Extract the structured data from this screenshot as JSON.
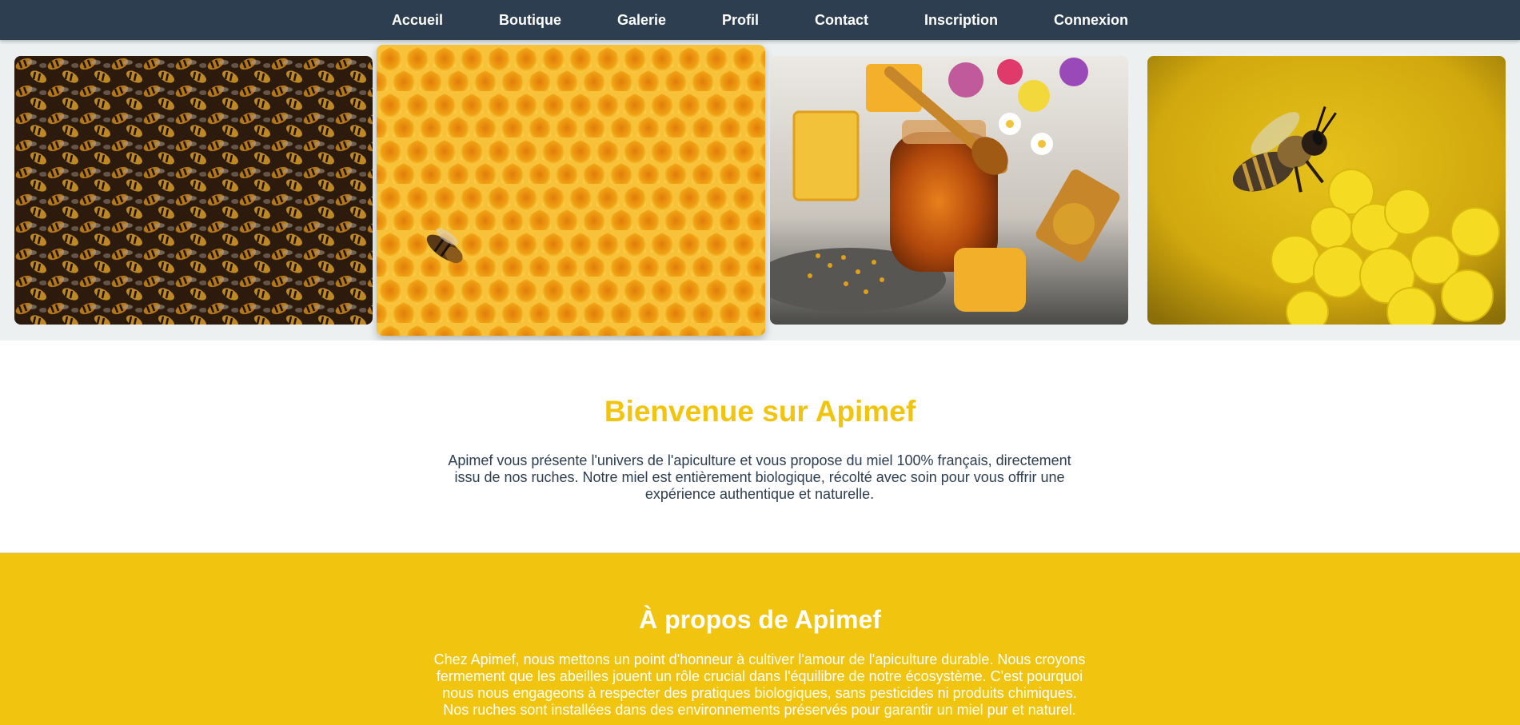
{
  "nav": {
    "items": [
      {
        "label": "Accueil"
      },
      {
        "label": "Boutique"
      },
      {
        "label": "Galerie"
      },
      {
        "label": "Profil"
      },
      {
        "label": "Contact"
      },
      {
        "label": "Inscription"
      },
      {
        "label": "Connexion"
      }
    ]
  },
  "gallery": {
    "images": [
      {
        "subject": "bee swarm"
      },
      {
        "subject": "honeycomb with bee"
      },
      {
        "subject": "honey jar with flowers and pollen"
      },
      {
        "subject": "bee on yellow flower"
      }
    ]
  },
  "welcome": {
    "title": "Bienvenue sur Apimef",
    "text": "Apimef vous présente l'univers de l'apiculture et vous propose du miel 100% français, directement issu de nos ruches. Notre miel est entièrement biologique, récolté avec soin pour vous offrir une expérience authentique et naturelle."
  },
  "about": {
    "title": "À propos de Apimef",
    "text": "Chez Apimef, nous mettons un point d'honneur à cultiver l'amour de l'apiculture durable. Nous croyons fermement que les abeilles jouent un rôle crucial dans l'équilibre de notre écosystème. C'est pourquoi nous nous engageons à respecter des pratiques biologiques, sans pesticides ni produits chimiques. Nos ruches sont installées dans des environnements préservés pour garantir un miel pur et naturel."
  },
  "colors": {
    "nav_bg": "#2c3e50",
    "accent": "#f1c40f",
    "text_dark": "#2c3e50",
    "gallery_bg": "#ecf0f1"
  }
}
